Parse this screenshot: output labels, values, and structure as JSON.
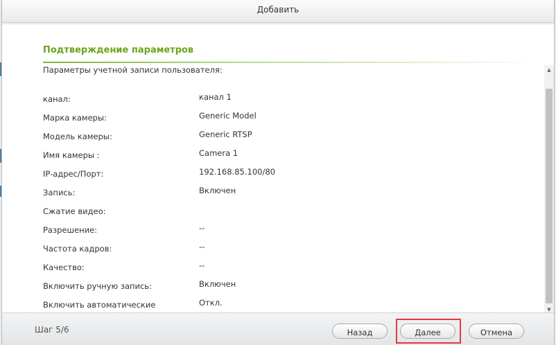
{
  "dialog": {
    "title": "Добавить"
  },
  "section": {
    "title": "Подтверждение параметров",
    "subtitle": "Параметры учетной записи пользователя:"
  },
  "fields": [
    {
      "label": "канал:",
      "value": "канал 1"
    },
    {
      "label": "Марка камеры:",
      "value": "Generic Model"
    },
    {
      "label": "Модель камеры:",
      "value": "Generic RTSP"
    },
    {
      "label": "Имя камеры :",
      "value": "Camera 1"
    },
    {
      "label": "IP-адрес/Порт:",
      "value": "192.168.85.100/80"
    },
    {
      "label": "Запись:",
      "value": "Включен"
    },
    {
      "label": "Сжатие видео:",
      "value": ""
    },
    {
      "label": "Разрешение:",
      "value": "--"
    },
    {
      "label": "Частота кадров:",
      "value": "--"
    },
    {
      "label": "Качество:",
      "value": "--"
    },
    {
      "label": "Включить ручную запись:",
      "value": "Включен"
    },
    {
      "label": "Включить автоматические",
      "value": "Откл."
    }
  ],
  "footer": {
    "step": "Шаг 5/6",
    "back_label": "Назад",
    "next_label": "Далее",
    "cancel_label": "Отмена"
  },
  "colors": {
    "accent_green": "#6aa51b",
    "highlight_red": "#e3393a"
  },
  "icons": {
    "scroll_up": "scroll-up-arrow-icon",
    "scroll_down": "scroll-down-arrow-icon"
  }
}
